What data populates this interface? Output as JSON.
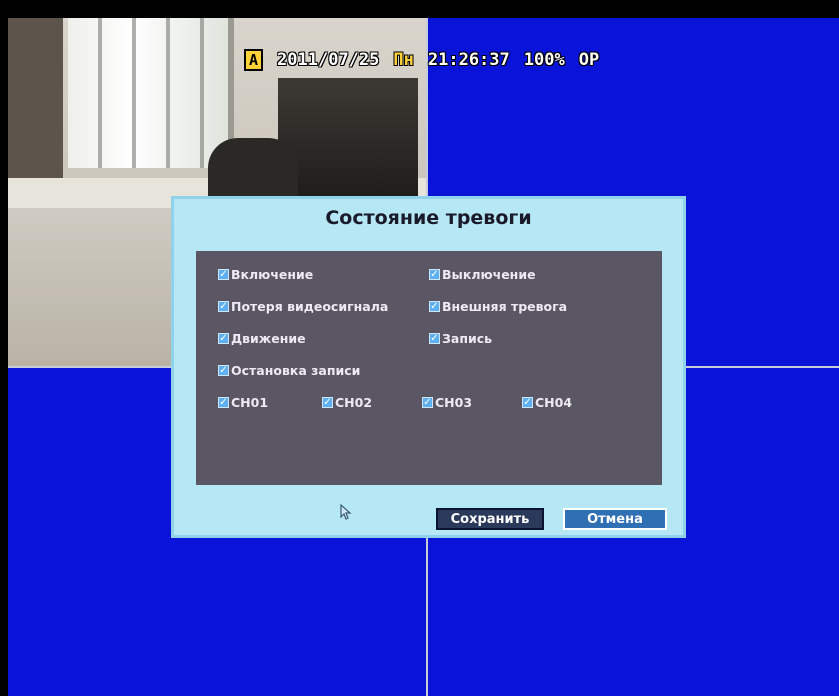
{
  "osd": {
    "channel_tag": "A",
    "date": "2011/07/25",
    "weekday": "Пн",
    "time": "21:26:37",
    "hdd": "100%",
    "mode": "OP"
  },
  "dialog": {
    "title": "Состояние тревоги",
    "checkboxes": [
      {
        "label": "Включение",
        "checked": true
      },
      {
        "label": "Выключение",
        "checked": true
      },
      {
        "label": "Потеря видеосигнала",
        "checked": true
      },
      {
        "label": "Внешняя тревога",
        "checked": true
      },
      {
        "label": "Движение",
        "checked": true
      },
      {
        "label": "Запись",
        "checked": true
      },
      {
        "label": "Остановка записи",
        "checked": true
      }
    ],
    "channels": [
      {
        "label": "CH01",
        "checked": true
      },
      {
        "label": "CH02",
        "checked": true
      },
      {
        "label": "CH03",
        "checked": true
      },
      {
        "label": "CH04",
        "checked": true
      }
    ],
    "save_label": "Сохранить",
    "cancel_label": "Отмена"
  },
  "icons": {
    "checkmark": "✓",
    "cursor": "pointer-cursor-icon"
  },
  "colors": {
    "background": "#0a14d8",
    "dialog": "#b6e7f4",
    "panel": "#5a5663",
    "osd_day": "#ffd23a"
  }
}
